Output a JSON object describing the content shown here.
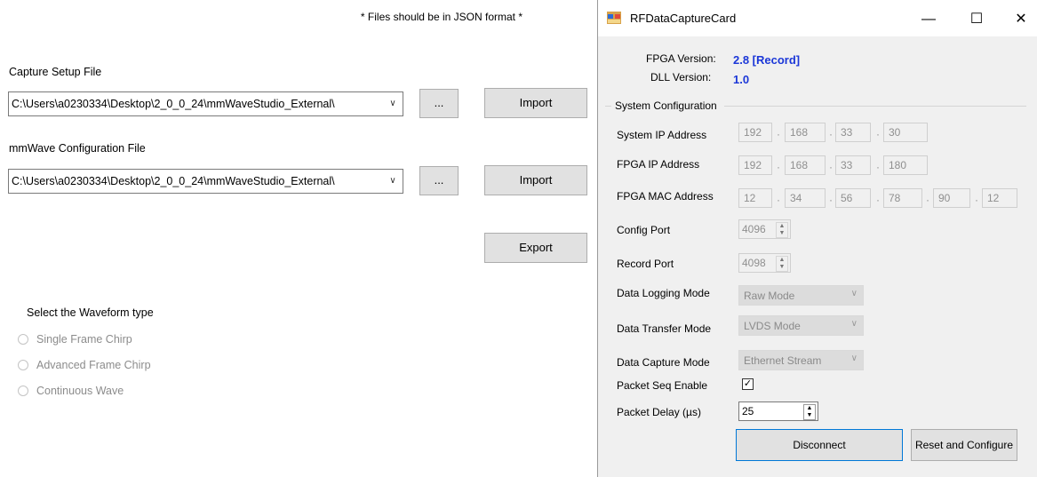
{
  "left": {
    "note": "* Files should be in JSON format *",
    "capture_label": "Capture Setup File",
    "capture_path": "C:\\Users\\a0230334\\Desktop\\2_0_0_24\\mmWaveStudio_External\\",
    "mmwave_label": "mmWave Configuration File",
    "mmwave_path": "C:\\Users\\a0230334\\Desktop\\2_0_0_24\\mmWaveStudio_External\\",
    "browse_label": "...",
    "import_label": "Import",
    "export_label": "Export",
    "waveform_title": "Select the Waveform type",
    "waveforms": [
      "Single Frame Chirp",
      "Advanced Frame Chirp",
      "Continuous Wave"
    ]
  },
  "dialog": {
    "title": "RFDataCaptureCard",
    "fpga_version_label": "FPGA Version:",
    "fpga_version": "2.8 [Record]",
    "dll_version_label": "DLL Version:",
    "dll_version": "1.0",
    "group_title": "System Configuration",
    "system_ip_label": "System IP Address",
    "system_ip": [
      "192",
      "168",
      "33",
      "30"
    ],
    "fpga_ip_label": "FPGA IP Address",
    "fpga_ip": [
      "192",
      "168",
      "33",
      "180"
    ],
    "fpga_mac_label": "FPGA MAC Address",
    "fpga_mac": [
      "12",
      "34",
      "56",
      "78",
      "90",
      "12"
    ],
    "config_port_label": "Config Port",
    "config_port": "4096",
    "record_port_label": "Record Port",
    "record_port": "4098",
    "logging_label": "Data Logging Mode",
    "logging_value": "Raw Mode",
    "transfer_label": "Data Transfer Mode",
    "transfer_value": "LVDS Mode",
    "capture_label": "Data Capture Mode",
    "capture_value": "Ethernet Stream",
    "packet_seq_label": "Packet Seq Enable",
    "packet_seq_checked": true,
    "packet_delay_label": "Packet Delay (µs)",
    "packet_delay": "25",
    "disconnect_label": "Disconnect",
    "reset_label": "Reset and Configure",
    "minimize": "—",
    "maximize": "☐",
    "close": "✕"
  },
  "colors": {
    "version_text": "#1b37d8",
    "accent_border": "#0078d7"
  }
}
